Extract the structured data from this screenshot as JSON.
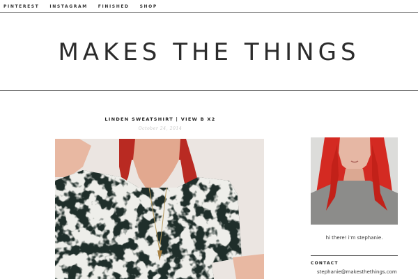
{
  "nav": {
    "items": [
      {
        "label": "PINTEREST"
      },
      {
        "label": "INSTAGRAM"
      },
      {
        "label": "FINISHED"
      },
      {
        "label": "SHOP"
      }
    ]
  },
  "header": {
    "site_title": "MAKES THE THINGS"
  },
  "post": {
    "title": "LINDEN SWEATSHIRT | VIEW B X2",
    "date": "October 24, 2014"
  },
  "sidebar": {
    "intro": "hi there! i'm stephanie.",
    "contact_heading": "CONTACT",
    "contact_email": "stephanie@makesthethings.com"
  },
  "colors": {
    "hair": "#c8241f",
    "shirt_dark": "#1f2e2a",
    "shirt_light": "#d9d8d0",
    "background": "#ffffff",
    "rule": "#555555"
  }
}
